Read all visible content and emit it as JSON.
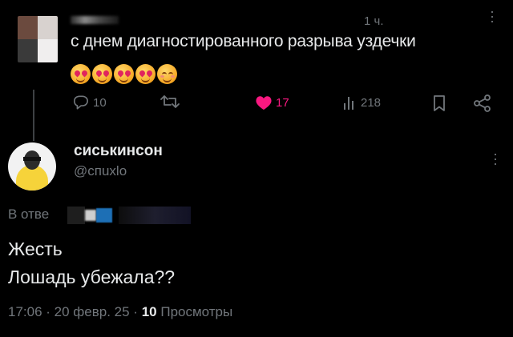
{
  "parent_tweet": {
    "time": "1 ч.",
    "text": "с днем диагностированного разрыва уздечки",
    "emojis": [
      "heart-eyes-emoji",
      "heart-eyes-emoji",
      "heart-eyes-emoji",
      "heart-eyes-emoji",
      "relieved-emoji"
    ],
    "actions": {
      "replies": "10",
      "retweets": "",
      "likes": "17",
      "views": "218"
    }
  },
  "reply_tweet": {
    "display_name": "сиськинсон",
    "handle": "@спuxlo",
    "replying_to_label": "В отве",
    "text_line_1": "Жесть",
    "text_line_2": "Лошадь убежала??",
    "timestamp": "17:06 · 20 февр. 25 ·",
    "views_count": "10",
    "views_label": "Просмотры"
  },
  "colors": {
    "background": "#000000",
    "text_primary": "#e7e9ea",
    "text_secondary": "#71767b",
    "like_pink": "#f91880"
  }
}
